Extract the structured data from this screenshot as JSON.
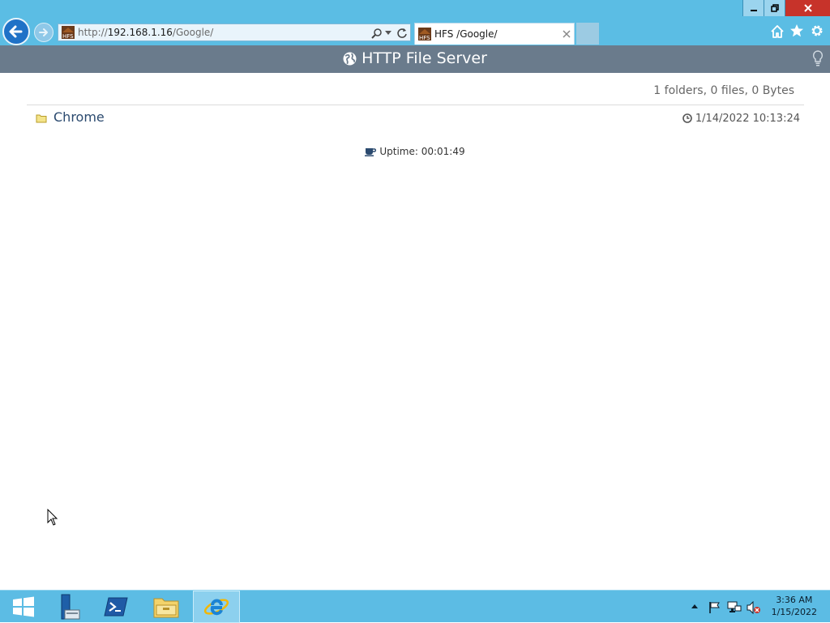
{
  "browser": {
    "address": {
      "prefix": "http://",
      "host": "192.168.1.16",
      "path": "/Google/"
    },
    "tab": {
      "title": "HFS /Google/"
    }
  },
  "page": {
    "title": "HTTP File Server",
    "summary": "1 folders, 0 files, 0 Bytes",
    "items": [
      {
        "name": "Chrome",
        "type": "folder",
        "date": "1/14/2022 10:13:24"
      }
    ],
    "uptime": "Uptime: 00:01:49"
  },
  "taskbar": {
    "time": "3:36 AM",
    "date": "1/15/2022"
  },
  "colors": {
    "chrome": "#5bbde4",
    "hfs_header": "#6a7b8c",
    "folder_link": "#2b4a6f"
  }
}
